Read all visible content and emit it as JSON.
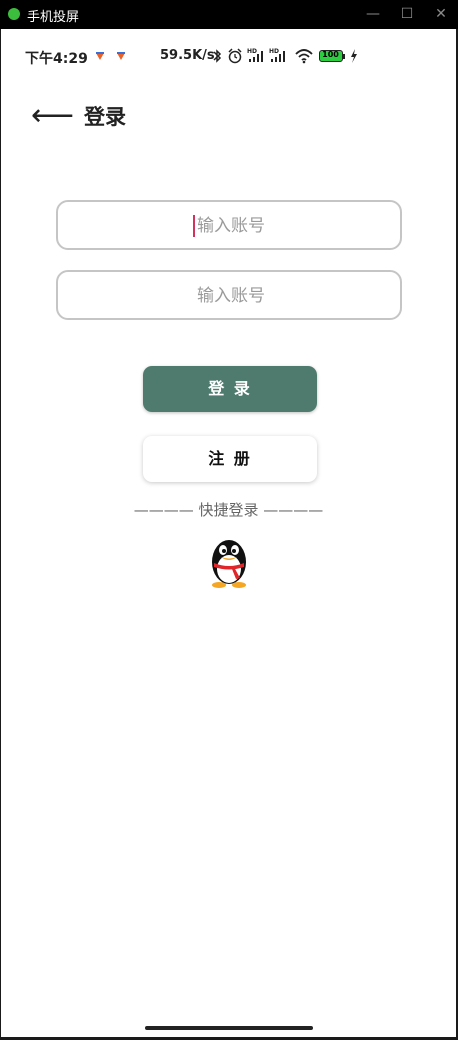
{
  "window": {
    "title": "手机投屏",
    "minimize": "—",
    "maximize": "☐",
    "close": "✕"
  },
  "status_bar": {
    "time": "下午4:29",
    "net_speed": "59.5K/s",
    "battery": "100",
    "icons": [
      "notification-icon",
      "notification-icon",
      "bluetooth-icon",
      "alarm-icon",
      "signal-hd-icon",
      "signal-hd-icon",
      "wifi-icon",
      "battery-icon",
      "charging-icon"
    ]
  },
  "header": {
    "back": "⟵",
    "title": "登录"
  },
  "form": {
    "account_placeholder": "输入账号",
    "password_placeholder": "输入账号"
  },
  "buttons": {
    "login": "登 录",
    "register": "注 册"
  },
  "quick_login": {
    "label": "———— 快捷登录 ————",
    "icon": "qq-icon"
  },
  "colors": {
    "login_button": "#4f7b6f",
    "caret": "#d4325c",
    "battery_fill": "#2ecc40"
  }
}
